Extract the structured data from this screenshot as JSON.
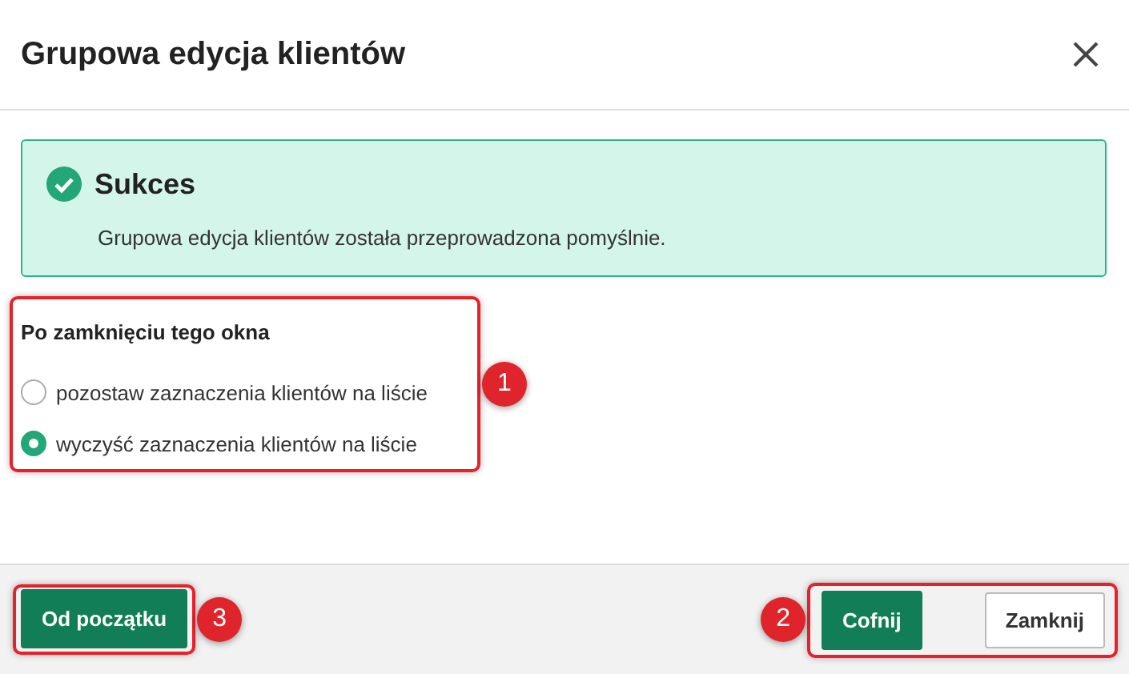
{
  "dialog": {
    "title": "Grupowa edycja klientów"
  },
  "alert": {
    "kind": "success",
    "title": "Sukces",
    "message": "Grupowa edycja klientów została przeprowadzona pomyślnie."
  },
  "close_options": {
    "heading": "Po zamknięciu tego okna",
    "annotation": {
      "label": "1",
      "kind": "trailing"
    },
    "options": [
      {
        "label": "pozostaw zaznaczenia klientów na liście",
        "selected": false
      },
      {
        "label": "wyczyść zaznaczenia klientów na liście",
        "selected": true
      }
    ]
  },
  "footer": {
    "left": {
      "annotation": {
        "label": "3",
        "kind": "trailing"
      },
      "buttons": [
        {
          "label": "Od początku",
          "kind": "primary"
        }
      ]
    },
    "right": {
      "annotation": {
        "label": "2",
        "kind": "leading"
      },
      "buttons": [
        {
          "label": "Cofnij",
          "kind": "primary"
        },
        {
          "label": "Zamknij",
          "kind": "secondary"
        }
      ]
    }
  }
}
